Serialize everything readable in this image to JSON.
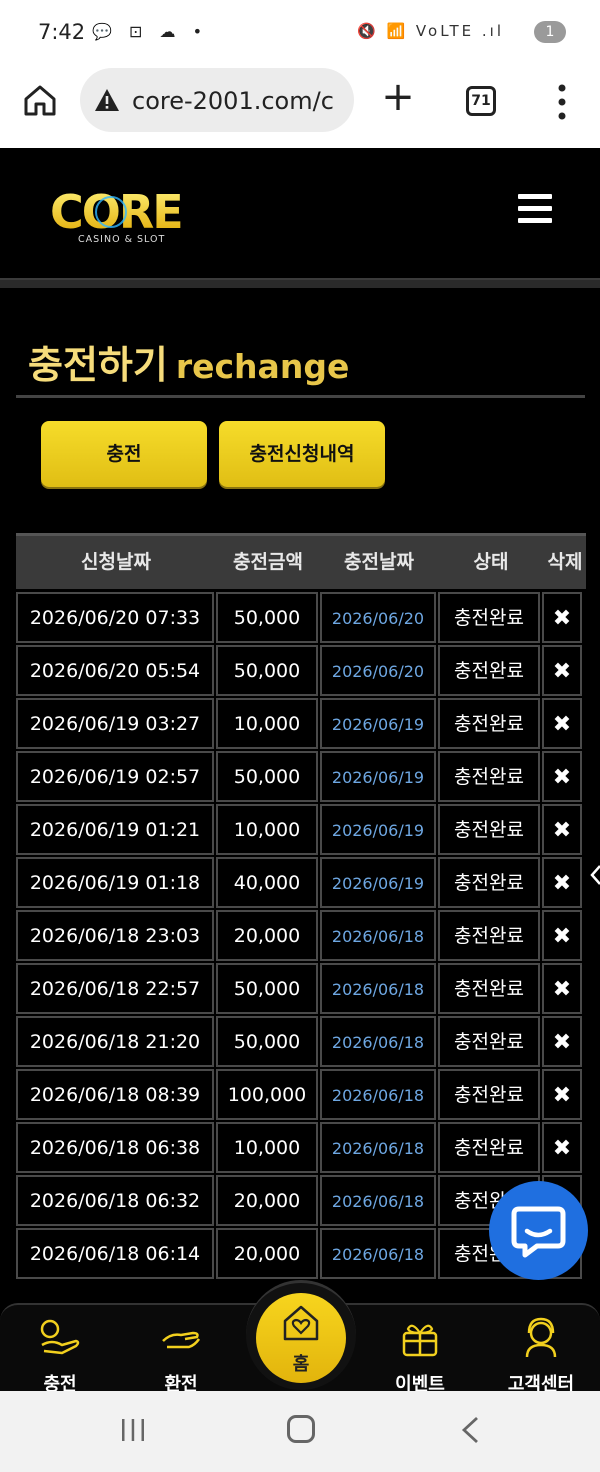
{
  "status_bar": {
    "time": "7:42",
    "left_icons": "💬 ⊡ ☁ •",
    "right_icons": "🔇 📶 VoLTE .ıl",
    "notification_count": "1"
  },
  "browser": {
    "url": "core-2001.com/c",
    "tab_count": "71"
  },
  "site": {
    "logo_text": "CORE",
    "logo_sub": "CASINO & SLOT"
  },
  "page": {
    "title_ko": "충전하기",
    "title_en": "rechange"
  },
  "buttons": {
    "charge": "충전",
    "history": "충전신청내역"
  },
  "table": {
    "headers": [
      "신청날짜",
      "충전금액",
      "충전날짜",
      "상태",
      "삭제"
    ],
    "rows": [
      {
        "request_date": "2026/06/20 07:33",
        "amount": "50,000",
        "charge_date": "2026/06/20",
        "status": "충전완료",
        "delete": "✖"
      },
      {
        "request_date": "2026/06/20 05:54",
        "amount": "50,000",
        "charge_date": "2026/06/20",
        "status": "충전완료",
        "delete": "✖"
      },
      {
        "request_date": "2026/06/19 03:27",
        "amount": "10,000",
        "charge_date": "2026/06/19",
        "status": "충전완료",
        "delete": "✖"
      },
      {
        "request_date": "2026/06/19 02:57",
        "amount": "50,000",
        "charge_date": "2026/06/19",
        "status": "충전완료",
        "delete": "✖"
      },
      {
        "request_date": "2026/06/19 01:21",
        "amount": "10,000",
        "charge_date": "2026/06/19",
        "status": "충전완료",
        "delete": "✖"
      },
      {
        "request_date": "2026/06/19 01:18",
        "amount": "40,000",
        "charge_date": "2026/06/19",
        "status": "충전완료",
        "delete": "✖"
      },
      {
        "request_date": "2026/06/18 23:03",
        "amount": "20,000",
        "charge_date": "2026/06/18",
        "status": "충전완료",
        "delete": "✖"
      },
      {
        "request_date": "2026/06/18 22:57",
        "amount": "50,000",
        "charge_date": "2026/06/18",
        "status": "충전완료",
        "delete": "✖"
      },
      {
        "request_date": "2026/06/18 21:20",
        "amount": "50,000",
        "charge_date": "2026/06/18",
        "status": "충전완료",
        "delete": "✖"
      },
      {
        "request_date": "2026/06/18 08:39",
        "amount": "100,000",
        "charge_date": "2026/06/18",
        "status": "충전완료",
        "delete": "✖"
      },
      {
        "request_date": "2026/06/18 06:38",
        "amount": "10,000",
        "charge_date": "2026/06/18",
        "status": "충전완료",
        "delete": "✖"
      },
      {
        "request_date": "2026/06/18 06:32",
        "amount": "20,000",
        "charge_date": "2026/06/18",
        "status": "충전완료",
        "delete": ""
      },
      {
        "request_date": "2026/06/18 06:14",
        "amount": "20,000",
        "charge_date": "2026/06/18",
        "status": "충전완료",
        "delete": ""
      }
    ]
  },
  "bottom_nav": {
    "charge": "충전",
    "exchange": "환전",
    "home": "홈",
    "event": "이벤트",
    "support": "고객센터"
  },
  "colors": {
    "accent_yellow": "#f2d01e",
    "title_gold": "#f3d36b",
    "link_blue": "#6ea7e2",
    "chat_blue": "#1f6fe0"
  }
}
